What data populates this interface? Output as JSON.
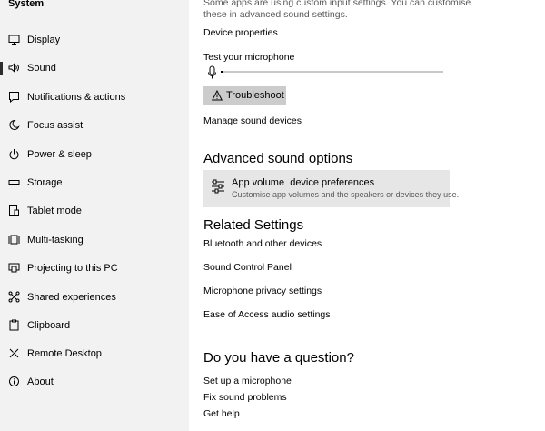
{
  "sidebar": {
    "title": "System",
    "items": [
      {
        "label": "Display",
        "icon": "display-icon",
        "active": false
      },
      {
        "label": "Sound",
        "icon": "speaker-icon",
        "active": true
      },
      {
        "label": "Notifications & actions",
        "icon": "notification-icon",
        "active": false
      },
      {
        "label": "Focus assist",
        "icon": "moon-icon",
        "active": false
      },
      {
        "label": "Power & sleep",
        "icon": "power-icon",
        "active": false
      },
      {
        "label": "Storage",
        "icon": "storage-icon",
        "active": false
      },
      {
        "label": "Tablet mode",
        "icon": "tablet-icon",
        "active": false
      },
      {
        "label": "Multi-tasking",
        "icon": "multitasking-icon",
        "active": false
      },
      {
        "label": "Projecting to this PC",
        "icon": "projecting-icon",
        "active": false
      },
      {
        "label": "Shared experiences",
        "icon": "shared-experiences-icon",
        "active": false
      },
      {
        "label": "Clipboard",
        "icon": "clipboard-icon",
        "active": false
      },
      {
        "label": "Remote Desktop",
        "icon": "remote-desktop-icon",
        "active": false
      },
      {
        "label": "About",
        "icon": "info-icon",
        "active": false
      }
    ]
  },
  "main": {
    "intro_line1": "Some apps are using custom input settings. You can customise",
    "intro_line2": "these in advanced sound settings.",
    "device_properties": "Device properties",
    "test_mic_label": "Test your microphone",
    "mic_level_percent": 1,
    "troubleshoot_label": "Troubleshoot",
    "manage_devices": "Manage sound devices",
    "advanced_heading": "Advanced sound options",
    "app_volume": {
      "title": "App volume  device preferences",
      "subtitle": "Customise app volumes and the speakers or devices they use."
    },
    "related_heading": "Related Settings",
    "related_links": [
      "Bluetooth and other devices",
      "Sound Control Panel",
      "Microphone privacy settings",
      "Ease of Access audio settings"
    ],
    "question_heading": "Do you have a question?",
    "question_links": [
      "Set up a microphone",
      "Fix sound problems",
      "Get help"
    ]
  }
}
